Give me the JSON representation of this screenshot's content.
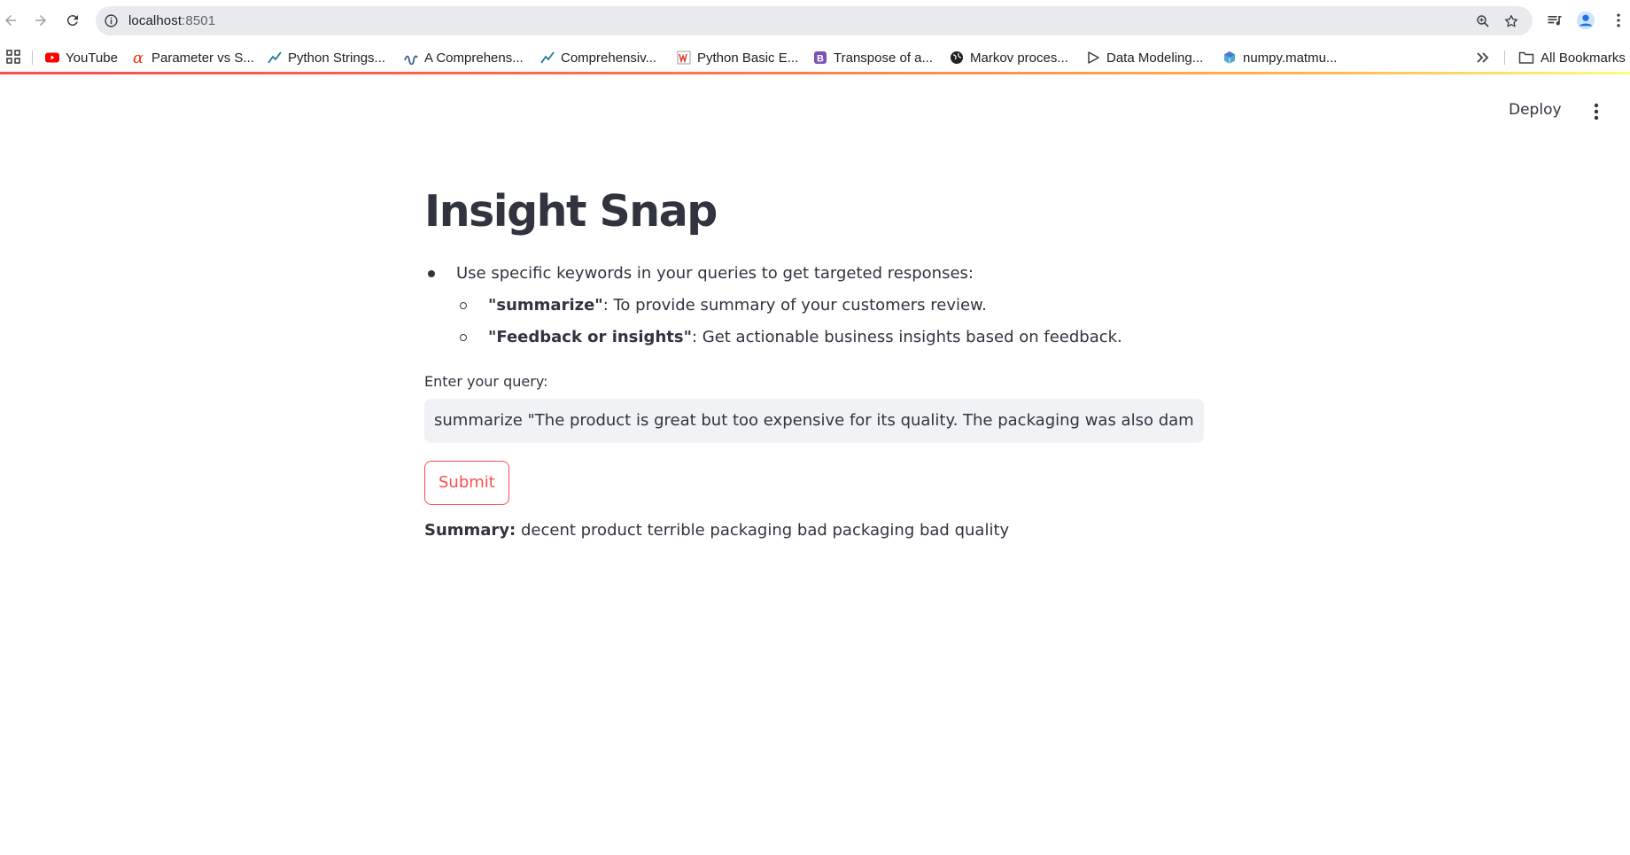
{
  "browser": {
    "url_host": "localhost",
    "url_port": ":8501",
    "bookmarks": [
      {
        "label": "YouTube",
        "icon": "youtube-icon"
      },
      {
        "label": "Parameter vs S...",
        "icon": "alpha-icon"
      },
      {
        "label": "Python Strings...",
        "icon": "chart-icon"
      },
      {
        "label": "A Comprehens...",
        "icon": "wave-icon"
      },
      {
        "label": "Comprehensiv...",
        "icon": "chart-icon"
      },
      {
        "label": "Python Basic E...",
        "icon": "w3-icon"
      },
      {
        "label": "Transpose of a...",
        "icon": "bootstrap-icon"
      },
      {
        "label": "Markov proces...",
        "icon": "globe-icon"
      },
      {
        "label": "Data Modeling...",
        "icon": "play-icon"
      },
      {
        "label": "numpy.matmu...",
        "icon": "cube-icon"
      }
    ],
    "all_bookmarks": "All Bookmarks"
  },
  "header": {
    "deploy_label": "Deploy"
  },
  "main": {
    "title": "Insight Snap",
    "intro": "Use specific keywords in your queries to get targeted responses:",
    "keywords": [
      {
        "keyword": "\"summarize\"",
        "description": ": To provide summary of your customers review."
      },
      {
        "keyword": "\"Feedback or insights\"",
        "description": ": Get actionable business insights based on feedback."
      }
    ],
    "query_label": "Enter your query:",
    "query_value": "summarize \"The product is great but too expensive for its quality. The packaging was also damaged when it arrived.\"",
    "submit_label": "Submit",
    "summary_label": "Summary:",
    "summary_text": " decent product terrible packaging bad packaging bad quality"
  },
  "colors": {
    "accent": "#ff4b4b",
    "text": "#31333f",
    "input_bg": "#f0f2f6"
  }
}
